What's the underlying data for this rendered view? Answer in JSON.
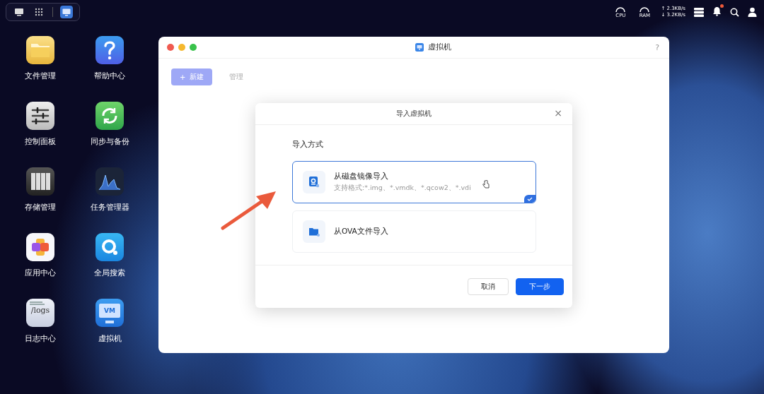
{
  "taskbar": {
    "items": [
      {
        "kind": "desktop",
        "selected": false
      },
      {
        "kind": "launcher",
        "selected": false
      },
      {
        "kind": "vm",
        "selected": true
      }
    ]
  },
  "status": {
    "cpu_label": "CPU",
    "ram_label": "RAM",
    "upload": "↑ 2.3KB/s",
    "download": "↓ 3.2KB/s",
    "unread_notifications": true
  },
  "desktop_icons": [
    {
      "kind": "folder",
      "label": "文件管理"
    },
    {
      "kind": "help",
      "label": "帮助中心"
    },
    {
      "kind": "control",
      "label": "控制面板"
    },
    {
      "kind": "sync",
      "label": "同步与备份"
    },
    {
      "kind": "storage",
      "label": "存储管理"
    },
    {
      "kind": "monitor",
      "label": "任务管理器"
    },
    {
      "kind": "apps",
      "label": "应用中心"
    },
    {
      "kind": "search",
      "label": "全局搜索"
    },
    {
      "kind": "logs",
      "label": "日志中心",
      "icon_text": "/logs"
    },
    {
      "kind": "vm",
      "label": "虚拟机",
      "icon_text": "VM"
    }
  ],
  "window": {
    "title": "虚拟机",
    "help": "?",
    "toolbar": [
      {
        "kind": "button",
        "icon": "+",
        "label": "新建",
        "disabled": true
      },
      {
        "kind": "tab",
        "label": "管理",
        "disabled": true
      }
    ]
  },
  "dialog": {
    "title": "导入虚拟机",
    "close": "×",
    "section": "导入方式",
    "options": [
      {
        "kind": "disk",
        "title": "从磁盘镜像导入",
        "subtitle": "支持格式:*.img、*.vmdk、*.qcow2、*.vdi",
        "selected": true
      },
      {
        "kind": "folder",
        "title": "从OVA文件导入",
        "selected": false
      }
    ],
    "buttons": [
      {
        "kind": "secondary",
        "label": "取消"
      },
      {
        "kind": "primary",
        "label": "下一步"
      }
    ]
  }
}
